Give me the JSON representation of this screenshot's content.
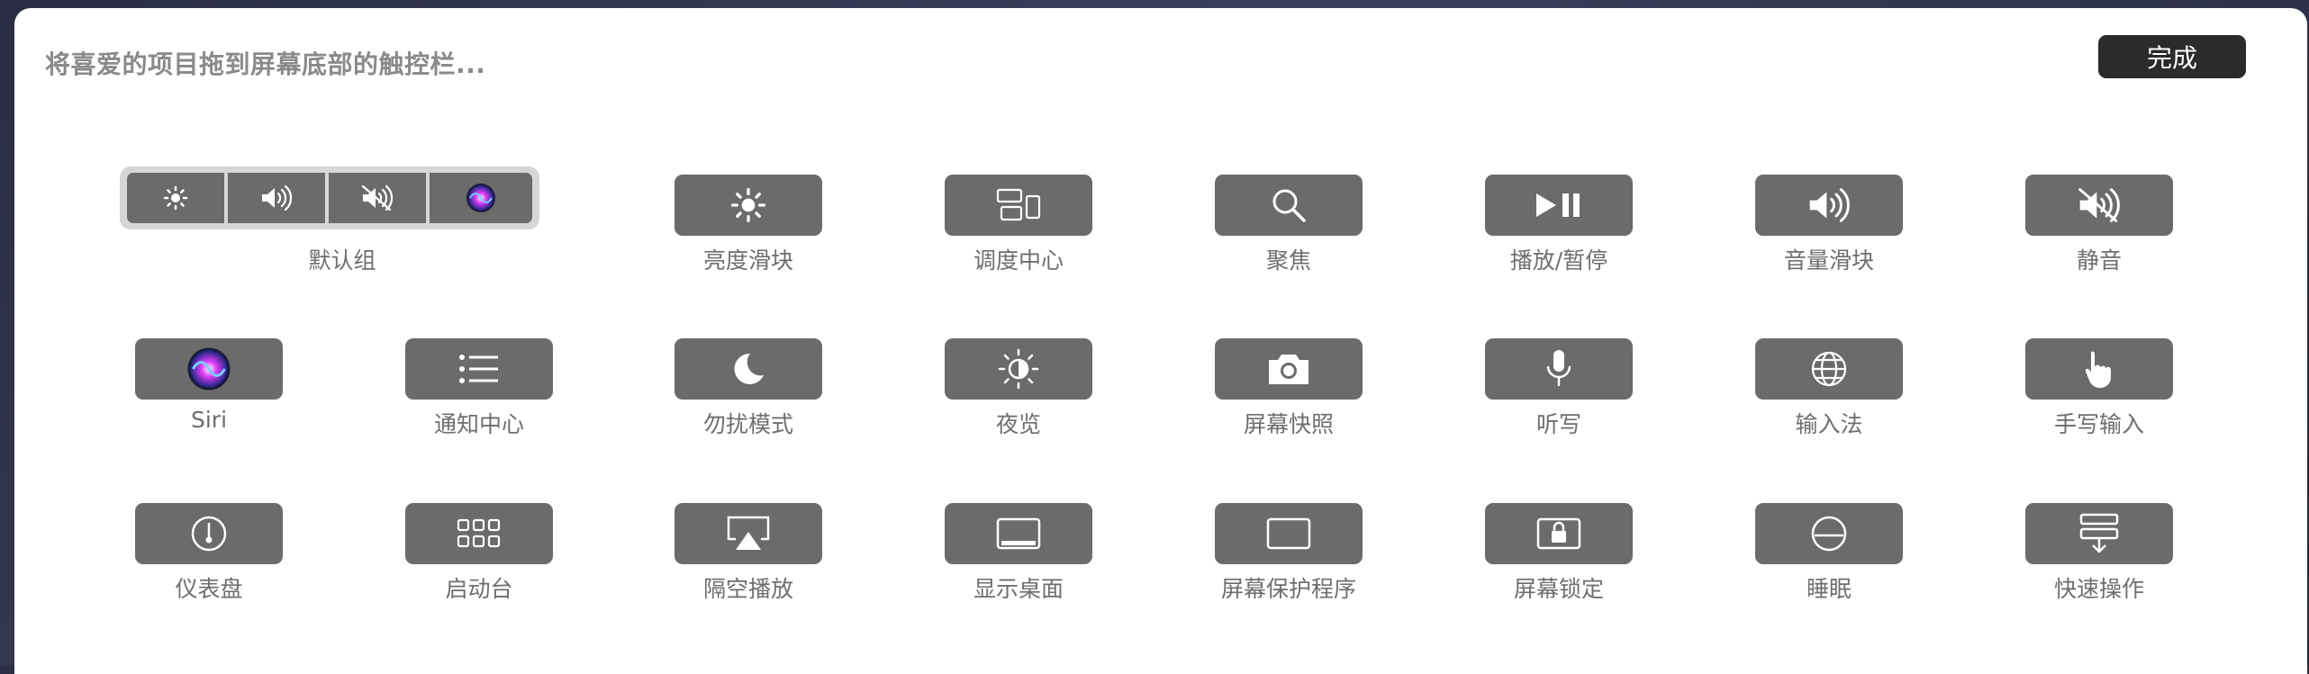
{
  "header": {
    "instruction": "将喜爱的项目拖到屏幕底部的触控栏...",
    "done_label": "完成"
  },
  "default_group": {
    "label": "默认组",
    "icons": [
      "brightness-icon",
      "volume-icon",
      "mute-icon",
      "siri-icon"
    ]
  },
  "items": [
    {
      "label": "亮度滑块",
      "icon": "brightness-icon"
    },
    {
      "label": "调度中心",
      "icon": "mission-control-icon"
    },
    {
      "label": "聚焦",
      "icon": "search-icon"
    },
    {
      "label": "播放/暂停",
      "icon": "play-pause-icon"
    },
    {
      "label": "音量滑块",
      "icon": "volume-icon"
    },
    {
      "label": "静音",
      "icon": "mute-icon"
    },
    {
      "label": "Siri",
      "icon": "siri-icon"
    },
    {
      "label": "通知中心",
      "icon": "list-icon"
    },
    {
      "label": "勿扰模式",
      "icon": "moon-icon"
    },
    {
      "label": "夜览",
      "icon": "night-shift-icon"
    },
    {
      "label": "屏幕快照",
      "icon": "camera-icon"
    },
    {
      "label": "听写",
      "icon": "microphone-icon"
    },
    {
      "label": "输入法",
      "icon": "globe-icon"
    },
    {
      "label": "手写输入",
      "icon": "hand-pointer-icon"
    },
    {
      "label": "仪表盘",
      "icon": "gauge-icon"
    },
    {
      "label": "启动台",
      "icon": "grid-icon"
    },
    {
      "label": "隔空播放",
      "icon": "airplay-icon"
    },
    {
      "label": "显示桌面",
      "icon": "desktop-icon"
    },
    {
      "label": "屏幕保护程序",
      "icon": "screensaver-icon"
    },
    {
      "label": "屏幕锁定",
      "icon": "lock-icon"
    },
    {
      "label": "睡眠",
      "icon": "sleep-icon"
    },
    {
      "label": "快速操作",
      "icon": "quick-actions-icon"
    }
  ]
}
